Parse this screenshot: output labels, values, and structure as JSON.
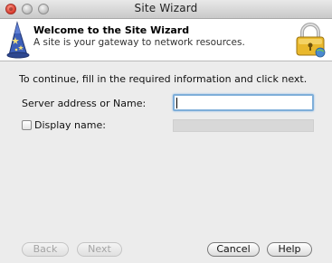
{
  "window": {
    "title": "Site Wizard"
  },
  "header": {
    "title": "Welcome to the Site Wizard",
    "subtitle": "A site is your gateway to network resources."
  },
  "main": {
    "instruction": "To continue, fill in the required information and click next.",
    "server_label": "Server address or Name:",
    "server_value": "",
    "display_checkbox_checked": false,
    "display_label": "Display name:",
    "display_value": ""
  },
  "buttons": {
    "back": "Back",
    "next": "Next",
    "cancel": "Cancel",
    "help": "Help"
  },
  "icons": {
    "window_close": "close-icon",
    "window_minimize": "minimize-icon",
    "window_zoom": "zoom-icon",
    "wizard": "wizard-hat-icon",
    "lock": "lock-icon"
  }
}
